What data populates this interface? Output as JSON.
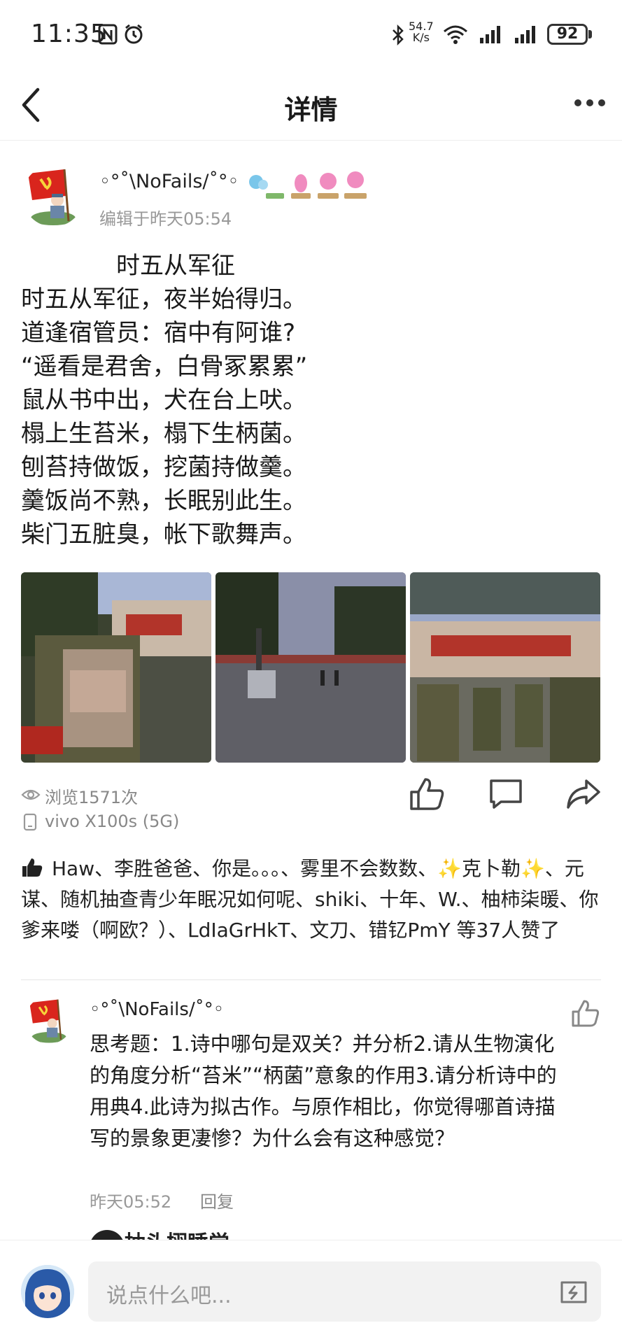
{
  "status_bar": {
    "time": "11:35",
    "net_speed_value": "54.7",
    "net_speed_unit": "K/s",
    "battery": "92"
  },
  "header": {
    "title": "详情"
  },
  "post": {
    "author": "◦°˚\\NoFails/˚°◦",
    "edited": "编辑于昨天05:54",
    "poem_title": "时五从军征",
    "poem_lines": [
      "时五从军征，夜半始得归。",
      "道逢宿管员：宿中有阿谁?",
      "“遥看是君舍，白骨冢累累”",
      "鼠从书中出，犬在台上吠。",
      "榻上生苔米，榻下生柄菌。",
      "刨苔持做饭，挖菌持做羹。",
      "羹饭尚不熟，长眠别此生。",
      "柴门五脏臭，帐下歌舞声。"
    ],
    "views": "浏览1571次",
    "device": "vivo X100s (5G)",
    "likes_text": "Haw、李胜爸爸、你是。。。、雾里不会数数、✨克卜勒✨、元谋、随机抽查青少年眠况如何呢、shiki、十年、W.、柚柿柒暖、你爹来喽（啊欧？）、LdIaGrHkT、文刀、错钇PmY 等37人赞了"
  },
  "comment": {
    "author": "◦°˚\\NoFails/˚°◦",
    "text": "思考题：1.诗中哪句是双关？并分析2.请从生物演化的角度分析“苔米”“柄菌”意象的作用3.请分析诗中的用典4.此诗为拟古作。与原作相比，你觉得哪首诗描写的景象更凄惨？为什么会有这种感觉？",
    "time": "昨天05:52",
    "reply": "回复"
  },
  "next_comment": {
    "author_partial": "抽头栩睡觉"
  },
  "input": {
    "placeholder": "说点什么吧..."
  },
  "colors": {
    "accent_red": "#d9251d",
    "text": "#1a1a1a",
    "muted": "#999999"
  },
  "icons": [
    "back-arrow-icon",
    "more-icon",
    "eye-icon",
    "phone-icon",
    "thumb-up-icon",
    "comment-icon",
    "share-icon",
    "emoji-icon"
  ]
}
